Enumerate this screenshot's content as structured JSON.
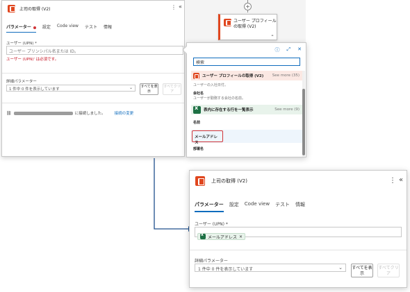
{
  "top_panel": {
    "title": "上司の取得 (V2)",
    "more_icon": "⋮",
    "collapse_icon": "«",
    "tabs": [
      {
        "label": "パラメーター"
      },
      {
        "label": "設定"
      },
      {
        "label": "Code view"
      },
      {
        "label": "テスト"
      },
      {
        "label": "情報"
      }
    ],
    "upn_label": "ユーザー (UPN) *",
    "upn_placeholder": "ユーザー プリンシパル名または ID。",
    "upn_error": "ユーザー (UPN)' は必須です。",
    "advanced_label": "詳細パラメーター",
    "advanced_value": "1 件中 0 件を表示しています",
    "show_all_label": "すべてを表示",
    "clear_all_label": "すべてクリア",
    "connected_text": "に接続しました。",
    "change_connection_label": "接続の変更"
  },
  "canvas_card": {
    "title": "ユーザー プロフィールの取得 (V2)",
    "plus": "+",
    "link_icon": "link-icon"
  },
  "dropdown": {
    "search_value": "検索",
    "groups": [
      {
        "title": "ユーザー プロフィールの取得 (V2)",
        "see_more": "See more (35)",
        "bg": "#fbe8e3"
      },
      {
        "title": "表内に存在する行を一覧表示",
        "see_more": "See more (9)",
        "bg": "#e8f3eb"
      }
    ],
    "items": [
      {
        "name": "",
        "desc": "ユーザーの入社日付。"
      },
      {
        "name": "会社名",
        "desc": "ユーザーが勤務する会社の名前。"
      },
      {
        "name": "名前",
        "desc": ""
      },
      {
        "name": "メールアドレス",
        "desc": ""
      },
      {
        "name": "部署名",
        "desc": ""
      }
    ]
  },
  "bottom_panel": {
    "title": "上司の取得 (V2)",
    "more_icon": "⋮",
    "collapse_icon": "«",
    "tabs": [
      {
        "label": "パラメーター"
      },
      {
        "label": "設定"
      },
      {
        "label": "Code view"
      },
      {
        "label": "テスト"
      },
      {
        "label": "情報"
      }
    ],
    "upn_label": "ユーザー (UPN) *",
    "token_label": "メールアドレス",
    "token_remove": "×",
    "advanced_label": "詳細パラメーター",
    "advanced_value": "1 件中 0 件を表示しています",
    "show_all_label": "すべてを表示",
    "clear_all_label": "すべてクリア"
  },
  "colors": {
    "accent": "#0f6cbd",
    "office": "#e0461e",
    "excel": "#1d7044",
    "error": "#c50f1f"
  }
}
